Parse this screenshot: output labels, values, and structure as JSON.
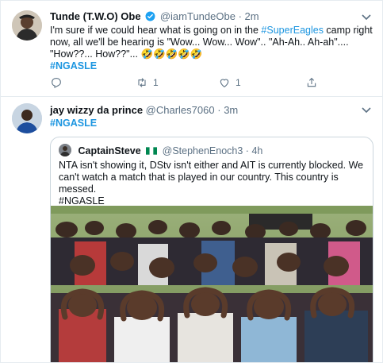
{
  "tweets": [
    {
      "name": "Tunde (T.W.O) Obe",
      "handle": "@iamTundeObe",
      "separator": "·",
      "time": "2m",
      "text_before_link": "I'm sure if we could hear what is going on in the ",
      "link": "#SuperEagles",
      "text_after_link": " camp right now, all we'll be hearing is \"Wow... Wow... Wow\".. \"Ah-Ah.. Ah-ah\".... \"How??... How??\"... ",
      "emoji": "🤣🤣🤣🤣🤣",
      "hashtag": "#NGASLE",
      "replies": "",
      "retweets": "1",
      "likes": "1"
    },
    {
      "name": "jay wizzy da prince",
      "handle": "@Charles7060",
      "separator": "·",
      "time": "3m",
      "hashtag": "#NGASLE",
      "quote": {
        "name": "CaptainSteve",
        "handle": "@StephenEnoch3",
        "separator": "·",
        "time": "4h",
        "text": "NTA isn't showing it, DStv isn't either and AIT is currently blocked. We can't watch a match that is played in our country. This country is messed.",
        "hashtag": "#NGASLE"
      }
    }
  ],
  "colors": {
    "accent": "#1b95e0",
    "muted": "#5b7083",
    "text": "#0f1419",
    "border": "#e6ecf0"
  },
  "icons": [
    "verified-badge-icon",
    "caret-down-icon",
    "reply-icon",
    "retweet-icon",
    "like-icon",
    "share-icon",
    "nigeria-flag-icon"
  ]
}
